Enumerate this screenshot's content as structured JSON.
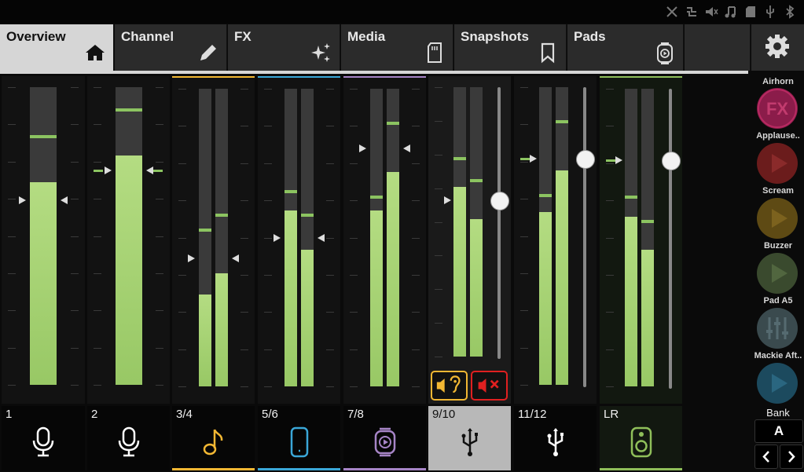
{
  "tabs": [
    {
      "label": "Overview",
      "icon": "home-icon",
      "active": true
    },
    {
      "label": "Channel",
      "icon": "pencil-icon",
      "active": false
    },
    {
      "label": "FX",
      "icon": "sparkles-icon",
      "active": false
    },
    {
      "label": "Media",
      "icon": "sd-card-icon",
      "active": false
    },
    {
      "label": "Snapshots",
      "icon": "bookmark-icon",
      "active": false
    },
    {
      "label": "Pads",
      "icon": "pad-icon",
      "active": false
    }
  ],
  "settings_icon": "gear-icon",
  "channels": [
    {
      "name": "1",
      "icon": "microphone-icon",
      "color": "#ffffff"
    },
    {
      "name": "2",
      "icon": "microphone-icon",
      "color": "#ffffff"
    },
    {
      "name": "3/4",
      "icon": "music-note-icon",
      "color": "#f2b733"
    },
    {
      "name": "5/6",
      "icon": "phone-icon",
      "color": "#3aa7d8"
    },
    {
      "name": "7/8",
      "icon": "media-player-icon",
      "color": "#a684c6"
    },
    {
      "name": "9/10",
      "icon": "usb-icon",
      "color": "#111111",
      "active": true
    },
    {
      "name": "11/12",
      "icon": "usb-icon",
      "color": "#ffffff"
    },
    {
      "name": "LR",
      "icon": "speaker-icon",
      "color": "#8fbf5a"
    }
  ],
  "channel_levels": {
    "ch1": {
      "fader": 0.62,
      "meters": [
        0.68
      ],
      "peaks": [
        0.84
      ]
    },
    "ch2": {
      "fader": 0.72,
      "meters": [
        0.77
      ],
      "peaks": [
        0.93
      ]
    },
    "ch34": {
      "fader": 0.43,
      "meters": [
        0.31,
        0.38
      ],
      "peaks": [
        0.53,
        0.58
      ]
    },
    "ch56": {
      "fader": 0.5,
      "meters": [
        0.59,
        0.46
      ],
      "peaks": [
        0.66,
        0.58
      ]
    },
    "ch78": {
      "fader": 0.8,
      "meters": [
        0.59,
        0.72
      ],
      "peaks": [
        0.64,
        0.89
      ]
    },
    "ch910": {
      "fader": 0.58,
      "meters": [
        0.63,
        0.51
      ],
      "peaks": [
        0.74,
        0.66
      ]
    },
    "ch1112": {
      "fader": 0.76,
      "meters": [
        0.58,
        0.72
      ],
      "peaks": [
        0.64,
        0.89
      ]
    },
    "lr": {
      "fader": 0.76,
      "meters": [
        0.57,
        0.46
      ],
      "peaks": [
        0.64,
        0.56
      ]
    }
  },
  "monitor_buttons": [
    {
      "icon": "speaker-ear-icon",
      "color": "#f2b733"
    },
    {
      "icon": "mute-icon",
      "color": "#e02020"
    }
  ],
  "pads": [
    {
      "label": "Airhorn",
      "icon": "fx-icon",
      "color": "#8b1c4a"
    },
    {
      "label": "Applause..",
      "icon": "play-icon",
      "color": "#6b1c1c"
    },
    {
      "label": "Scream",
      "icon": "play-icon",
      "color": "#5e4a14"
    },
    {
      "label": "Buzzer",
      "icon": "play-icon",
      "color": "#3a4a2e"
    },
    {
      "label": "Pad A5",
      "icon": "sliders-icon",
      "color": "#3a4a4e"
    },
    {
      "label": "Mackie Aft..",
      "icon": "play-icon",
      "color": "#1c4a5e"
    }
  ],
  "bank": {
    "label": "Bank",
    "value": "A",
    "prev_icon": "chevron-left-icon",
    "next_icon": "chevron-right-icon"
  },
  "status_icons": [
    "no-network-icon",
    "routing-icon",
    "speaker-off-icon",
    "music-icon",
    "sd-card-icon",
    "usb-icon",
    "bluetooth-icon"
  ]
}
